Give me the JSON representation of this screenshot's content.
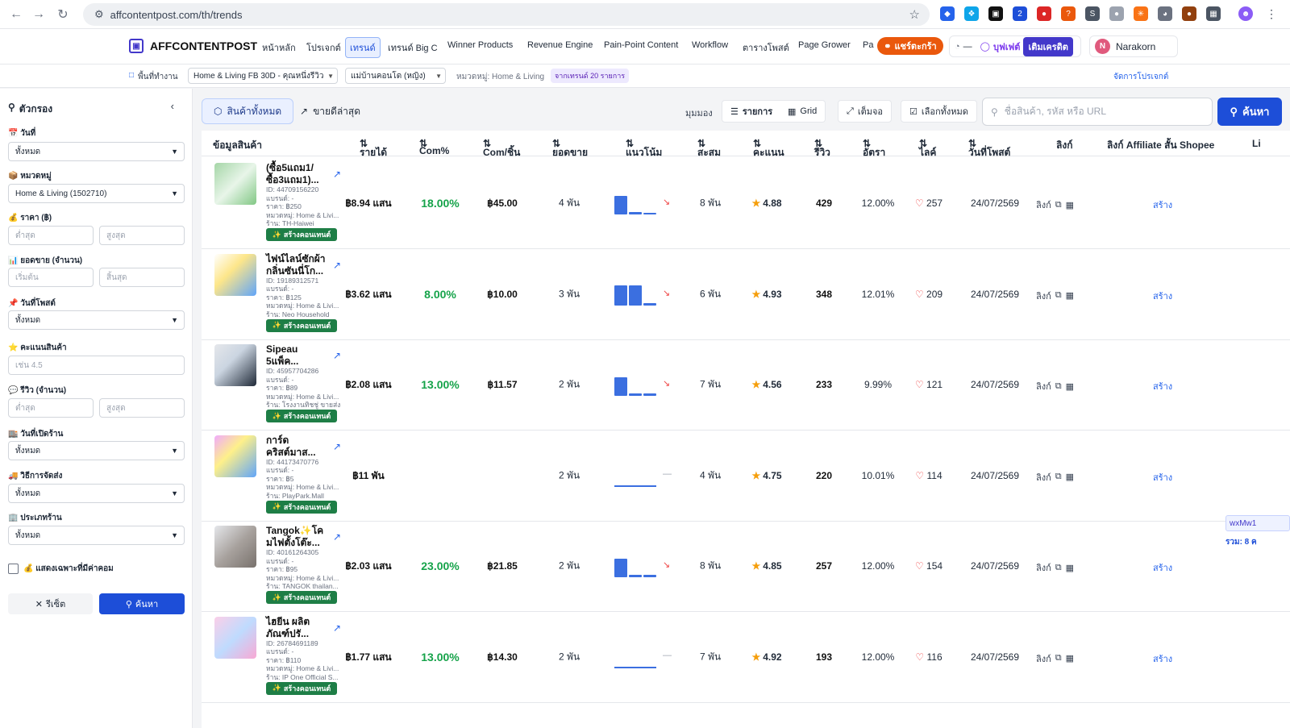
{
  "browser": {
    "url": "affcontentpost.com/th/trends"
  },
  "app": {
    "brand": "AFFCONTENTPOST",
    "nav": [
      "หน้าหลัก",
      "โปรเจกต์",
      "เทรนด์",
      "เทรนด์ Big C",
      "Winner Products",
      "Revenue Engine",
      "Pain-Point Content",
      "Workflow",
      "ตารางโพสต์",
      "Page Grower",
      "Pa"
    ],
    "share_label": "แชร์ตะกร้า",
    "credit_dash": "—",
    "buffet_label": "บุฟเฟต์",
    "topup_label": "เติมเครดิต",
    "user_initial": "N",
    "user_name": "Narakorn"
  },
  "workspace": {
    "label": "พื้นที่ทำงาน",
    "project": "Home & Living FB 30D - คุณหนึ่งรีวิว",
    "persona": "แม่บ้านคอนโด (หญิง)",
    "category": "หมวดหมู่: Home & Living",
    "count": "จากเทรนด์ 20 รายการ",
    "manage": "จัดการโปรเจกต์"
  },
  "filters": {
    "title": "ตัวกรอง",
    "day_label": "วันที่",
    "day_value": "ทั้งหมด",
    "category_label": "หมวดหมู่",
    "category_value": "Home & Living (1502710)",
    "price_label": "ราคา (฿)",
    "min_ph": "ต่ำสุด",
    "max_ph": "สูงสุด",
    "sales_label": "ยอดขาย (จำนวน)",
    "start_ph": "เริ่มต้น",
    "end_ph": "สิ้นสุด",
    "post_date_label": "วันที่โพสต์",
    "post_date_value": "ทั้งหมด",
    "rating_label": "คะแนนสินค้า",
    "rating_ph": "เช่น 4.5",
    "review_label": "รีวิว (จำนวน)",
    "shop_open_label": "วันที่เปิดร้าน",
    "shop_open_value": "ทั้งหมด",
    "shipping_label": "วิธีการจัดส่ง",
    "shipping_value": "ทั้งหมด",
    "shop_type_label": "ประเภทร้าน",
    "shop_type_value": "ทั้งหมด",
    "only_commission": "แสดงเฉพาะที่มีค่าคอม",
    "reset": "รีเซ็ต",
    "search": "ค้นหา"
  },
  "toolbar": {
    "tab_all": "สินค้าทั้งหมด",
    "tab_best": "ขายดีล่าสุด",
    "view_label": "มุมมอง",
    "list": "รายการ",
    "grid": "Grid",
    "fullscreen": "เต็มจอ",
    "select_all": "เลือกทั้งหมด",
    "search_ph": "ชื่อสินค้า, รหัส หรือ URL",
    "search_btn": "ค้นหา"
  },
  "columns": [
    "ข้อมูลสินค้า",
    "รายได้",
    "Com%",
    "Com/ชิ้น",
    "ยอดขาย",
    "แนวโน้ม",
    "สะสม",
    "คะแนน",
    "รีวิว",
    "อัตรา",
    "ไลค์",
    "วันที่โพสต์",
    "ลิงก์",
    "ลิงก์ Affiliate สั้น Shopee",
    "Li"
  ],
  "products": [
    {
      "name": "(ซื้อ5แถม1/ ซื้อ3แถม1)...",
      "id": "ID: 44709156220",
      "brand": "แบรนด์: -",
      "price": "ราคา: ฿250",
      "category": "หมวดหมู่: Home & Livi...",
      "shop": "ร้าน: TH-Haiwei",
      "revenue": "฿8.94 แสน",
      "com_pct": "18.00%",
      "com_unit": "฿45.00",
      "sales": "4 พัน",
      "trend": "down",
      "spark": [
        0.9,
        0.1,
        0
      ],
      "total": "8 พัน",
      "rating": "4.88",
      "reviews": "429",
      "rate": "12.00%",
      "likes": "257",
      "date": "24/07/2569"
    },
    {
      "name": "ไฟน์ไลน์ซักผ้า กลิ่นซันนี่โก...",
      "id": "ID: 19189312571",
      "brand": "แบรนด์: -",
      "price": "ราคา: ฿125",
      "category": "หมวดหมู่: Home & Livi...",
      "shop": "ร้าน: Neo Household",
      "revenue": "฿3.62 แสน",
      "com_pct": "8.00%",
      "com_unit": "฿10.00",
      "sales": "3 พัน",
      "trend": "down",
      "spark": [
        0.95,
        0.95,
        0.1
      ],
      "total": "6 พัน",
      "rating": "4.93",
      "reviews": "348",
      "rate": "12.01%",
      "likes": "209",
      "date": "24/07/2569"
    },
    {
      "name": "Sipeau 5แพ็ค...",
      "id": "ID: 45957704286",
      "brand": "แบรนด์: -",
      "price": "ราคา: ฿89",
      "category": "หมวดหมู่: Home & Livi...",
      "shop": "ร้าน: โรงงานทิชชู่ ขายส่ง...",
      "revenue": "฿2.08 แสน",
      "com_pct": "13.00%",
      "com_unit": "฿11.57",
      "sales": "2 พัน",
      "trend": "down",
      "spark": [
        0.9,
        0.1,
        0.1
      ],
      "total": "7 พัน",
      "rating": "4.56",
      "reviews": "233",
      "rate": "9.99%",
      "likes": "121",
      "date": "24/07/2569"
    },
    {
      "name": "การ์ด คริสต์มาส...",
      "id": "ID: 44173470776",
      "brand": "แบรนด์: -",
      "price": "ราคา: ฿5",
      "category": "หมวดหมู่: Home & Livi...",
      "shop": "ร้าน: PlayPark.Mall",
      "revenue": "฿11 พัน",
      "com_pct": "",
      "com_unit": "",
      "sales": "2 พัน",
      "trend": "flat",
      "spark": [],
      "total": "4 พัน",
      "rating": "4.75",
      "reviews": "220",
      "rate": "10.01%",
      "likes": "114",
      "date": "24/07/2569"
    },
    {
      "name": "Tangok✨โค มไฟตั้งโต๊ะ...",
      "id": "ID: 40161264305",
      "brand": "แบรนด์: -",
      "price": "ราคา: ฿95",
      "category": "หมวดหมู่: Home & Livi...",
      "shop": "ร้าน: TANGOK thailan...",
      "revenue": "฿2.03 แสน",
      "com_pct": "23.00%",
      "com_unit": "฿21.85",
      "sales": "2 พัน",
      "trend": "down",
      "spark": [
        0.9,
        0.1,
        0.1
      ],
      "total": "8 พัน",
      "rating": "4.85",
      "reviews": "257",
      "rate": "12.00%",
      "likes": "154",
      "date": "24/07/2569"
    },
    {
      "name": "ไฮยีน ผลิตภัณฑ์ปรั...",
      "id": "ID: 26784691189",
      "brand": "แบรนด์: -",
      "price": "ราคา: ฿110",
      "category": "หมวดหมู่: Home & Livi...",
      "shop": "ร้าน: IP One Official S...",
      "revenue": "฿1.77 แสน",
      "com_pct": "13.00%",
      "com_unit": "฿14.30",
      "sales": "2 พัน",
      "trend": "flat",
      "spark": [],
      "total": "7 พัน",
      "rating": "4.92",
      "reviews": "193",
      "rate": "12.00%",
      "likes": "116",
      "date": "24/07/2569"
    }
  ],
  "row_texts": {
    "create": "สร้างคอนเทนต์",
    "link": "ลิงก์",
    "create_short": "สร้าง"
  },
  "affiliate": {
    "tag": "wxMw1",
    "sum": "รวม: 8 ค"
  },
  "colors": {
    "primary": "#1d4ed8",
    "green": "#16a34a",
    "orange": "#ea580c",
    "create_bg": "#1e7e46"
  }
}
